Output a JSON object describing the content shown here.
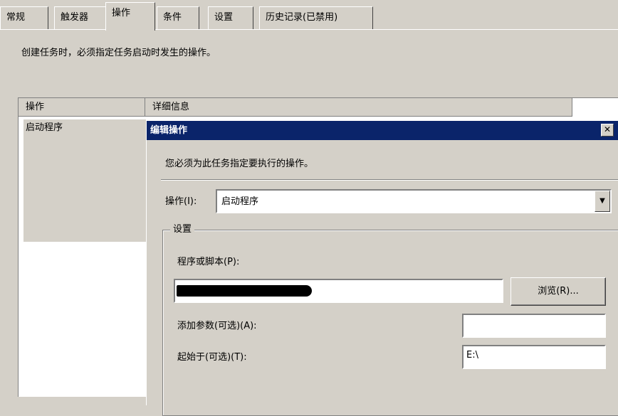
{
  "tabs": [
    {
      "label": "常规"
    },
    {
      "label": "触发器"
    },
    {
      "label": "操作",
      "active": true
    },
    {
      "label": "条件"
    },
    {
      "label": "设置"
    },
    {
      "label": "历史记录(已禁用)"
    }
  ],
  "actions_tab": {
    "hint": "创建任务时，必须指定任务启动时发生的操作。",
    "columns": [
      "操作",
      "详细信息"
    ],
    "rows": [
      {
        "action": "启动程序",
        "details": ""
      }
    ]
  },
  "dialog": {
    "title": "编辑操作",
    "close_glyph": "✕",
    "message": "您必须为此任务指定要执行的操作。",
    "action_label": "操作(I):",
    "action_value": "启动程序",
    "settings_group_title": "设置",
    "program_label": "程序或脚本(P):",
    "program_value": "",
    "browse_label": "浏览(R)...",
    "args_label": "添加参数(可选)(A):",
    "args_value": "",
    "start_in_label": "起始于(可选)(T):",
    "start_in_value": "E:\\"
  }
}
